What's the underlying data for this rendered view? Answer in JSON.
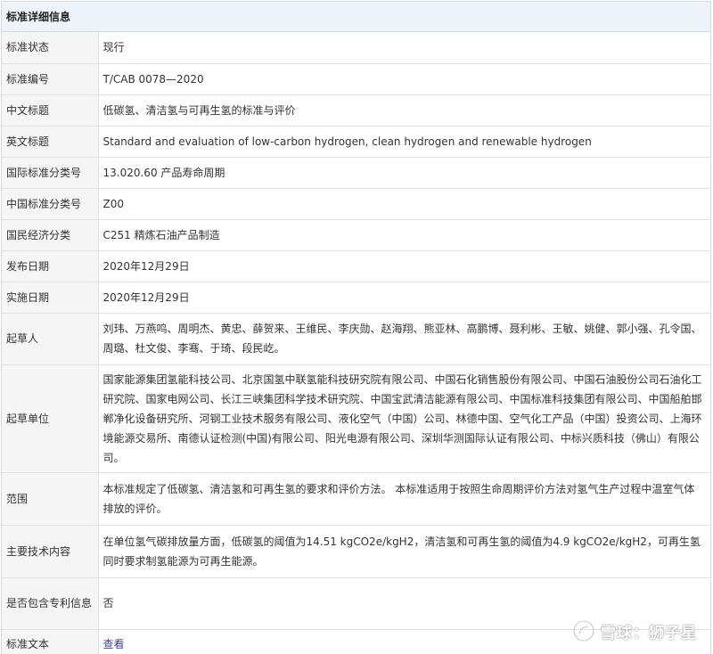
{
  "header": {
    "title": "标准详细信息"
  },
  "rows": [
    {
      "label": "标准状态",
      "value": "现行"
    },
    {
      "label": "标准编号",
      "value": "T/CAB 0078—2020"
    },
    {
      "label": "中文标题",
      "value": "低碳氢、清洁氢与可再生氢的标准与评价"
    },
    {
      "label": "英文标题",
      "value": "Standard and evaluation of low-carbon hydrogen, clean hydrogen and renewable hydrogen"
    },
    {
      "label": "国际标准分类号",
      "value": "13.020.60 产品寿命周期"
    },
    {
      "label": "中国标准分类号",
      "value": "Z00"
    },
    {
      "label": "国民经济分类",
      "value": "C251 精炼石油产品制造"
    },
    {
      "label": "发布日期",
      "value": "2020年12月29日"
    },
    {
      "label": "实施日期",
      "value": "2020年12月29日"
    },
    {
      "label": "起草人",
      "value": "刘玮、万燕鸣、周明杰、黄忠、薛贺来、王维民、李庆勋、赵海翔、熊亚林、高鹏博、聂利彬、王敏、姚健、郭小强、孔令国、周璐、杜文俊、李骞、于琦、段民屹。"
    },
    {
      "label": "起草单位",
      "value": "国家能源集团氢能科技公司、北京国氢中联氢能科技研究院有限公司、中国石化销售股份有限公司、中国石油股份公司石油化工研究院、国家电网公司、长江三峡集团科学技术研究院、中国宝武清洁能源有限公司、中国标准科技集团有限公司、中国船舶邯郸净化设备研究所、河钢工业技术服务有限公司、液化空气（中国）公司、林德中国、空气化工产品（中国）投资公司、上海环境能源交易所、南德认证检测(中国)有限公司、阳光电源有限公司、深圳华测国际认证有限公司、中标兴质科技（佛山）有限公司。"
    },
    {
      "label": "范围",
      "value": "本标准规定了低碳氢、清洁氢和可再生氢的要求和评价方法。 本标准适用于按照生命周期评价方法对氢气生产过程中温室气体排放的评价。"
    },
    {
      "label": "主要技术内容",
      "value": "在单位氢气碳排放量方面，低碳氢的阈值为14.51 kgCO2e/kgH2，清洁氢和可再生氢的阈值为4.9 kgCO2e/kgH2，可再生氢同时要求制氢能源为可再生能源。"
    },
    {
      "label": "是否包含专利信息",
      "value": "否"
    }
  ],
  "text_row": {
    "label": "标准文本",
    "link": "查看"
  },
  "watermark": {
    "text": "雪球：狮子星"
  },
  "colors": {
    "header_bg": "#eef3f9",
    "label_bg": "#f5f5f5",
    "border": "#d9d9d9",
    "link": "#3c3ca0"
  }
}
